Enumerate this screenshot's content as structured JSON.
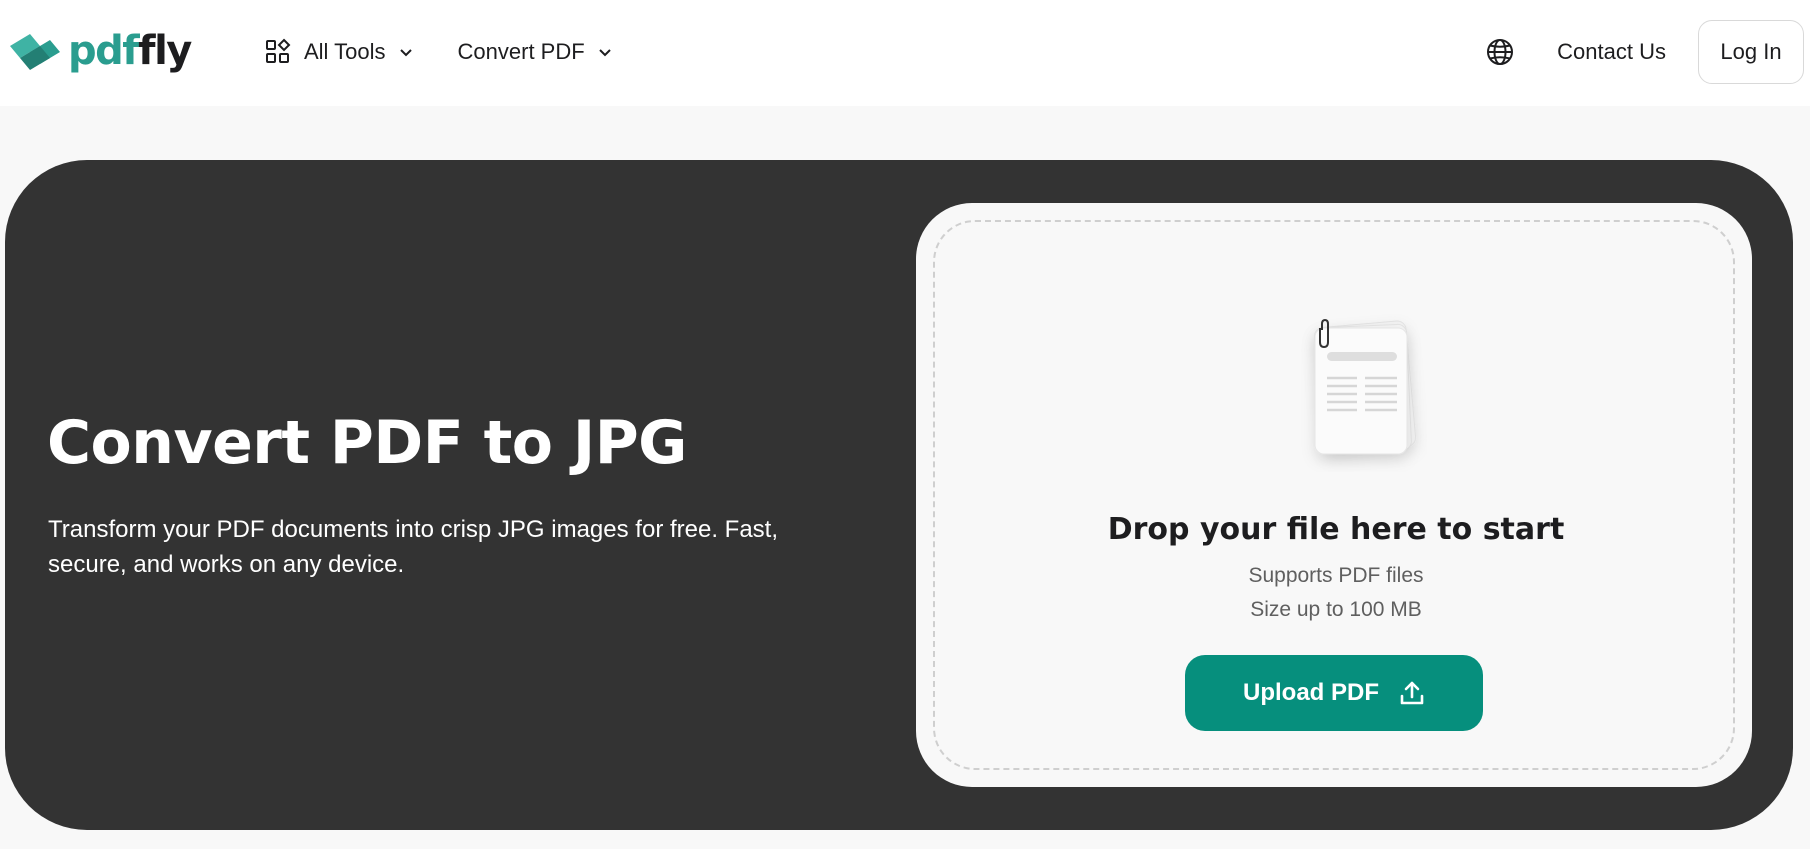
{
  "header": {
    "logo": {
      "part1": "pdf",
      "part2": "fly"
    },
    "nav": [
      {
        "label": "All Tools",
        "icon": "grid-icon"
      },
      {
        "label": "Convert PDF"
      }
    ],
    "language_icon": "globe-icon",
    "contact_label": "Contact Us",
    "login_label": "Log In"
  },
  "hero": {
    "title": "Convert PDF to JPG",
    "subtitle": "Transform your PDF documents into crisp JPG images for free. Fast, secure, and works on any device."
  },
  "upload": {
    "illustration": "document-stack-icon",
    "title": "Drop your file here to start",
    "line1": "Supports PDF files",
    "line2": "Size up to 100 MB",
    "button_label": "Upload PDF",
    "button_icon": "upload-icon"
  },
  "colors": {
    "brand": "#2a9d8f",
    "button": "#068f7d",
    "hero_bg": "#333333",
    "page_bg": "#f8f8f8"
  }
}
